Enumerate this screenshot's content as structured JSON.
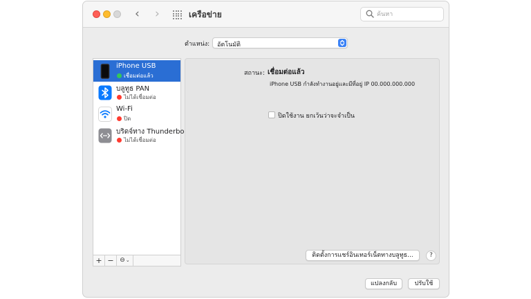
{
  "window": {
    "title": "เครือข่าย"
  },
  "search": {
    "placeholder": "ค้นหา"
  },
  "location": {
    "label": "ตำแหน่ง:",
    "value": "อัตโนมัติ"
  },
  "services": [
    {
      "name": "iPhone USB",
      "status": "เชื่อมต่อแล้ว",
      "status_color": "#34c759",
      "icon": "iphone-icon",
      "selected": true
    },
    {
      "name": "บลูทูธ PAN",
      "status": "ไม่ได้เชื่อมต่อ",
      "status_color": "#ff3b30",
      "icon": "bluetooth-icon",
      "selected": false
    },
    {
      "name": "Wi-Fi",
      "status": "ปิด",
      "status_color": "#ff3b30",
      "icon": "wifi-icon",
      "selected": false
    },
    {
      "name": "บริดจ์ทาง Thunderbolt",
      "status": "ไม่ได้เชื่อมต่อ",
      "status_color": "#ff3b30",
      "icon": "thunderbolt-bridge-icon",
      "selected": false
    }
  ],
  "toolbar": {
    "add": "+",
    "remove": "−",
    "action": "⊖"
  },
  "detail": {
    "status_label": "สถานะ:",
    "status_value": "เชื่อมต่อแล้ว",
    "status_desc": "iPhone USB กำลังทำงานอยู่และมีที่อยู่ IP 00.000.000.000",
    "checkbox_label": "ปิดใช้งาน ยกเว้นว่าจะจำเป็น",
    "bt_button": "ติดตั้งการแชร์อินเทอร์เน็ตทางบลูทูธ...",
    "help": "?"
  },
  "buttons": {
    "revert": "แปลงกลับ",
    "apply": "ปรับใช้"
  },
  "colors": {
    "accent": "#2a6ed4",
    "connected": "#34c759",
    "disconnected": "#ff3b30"
  }
}
